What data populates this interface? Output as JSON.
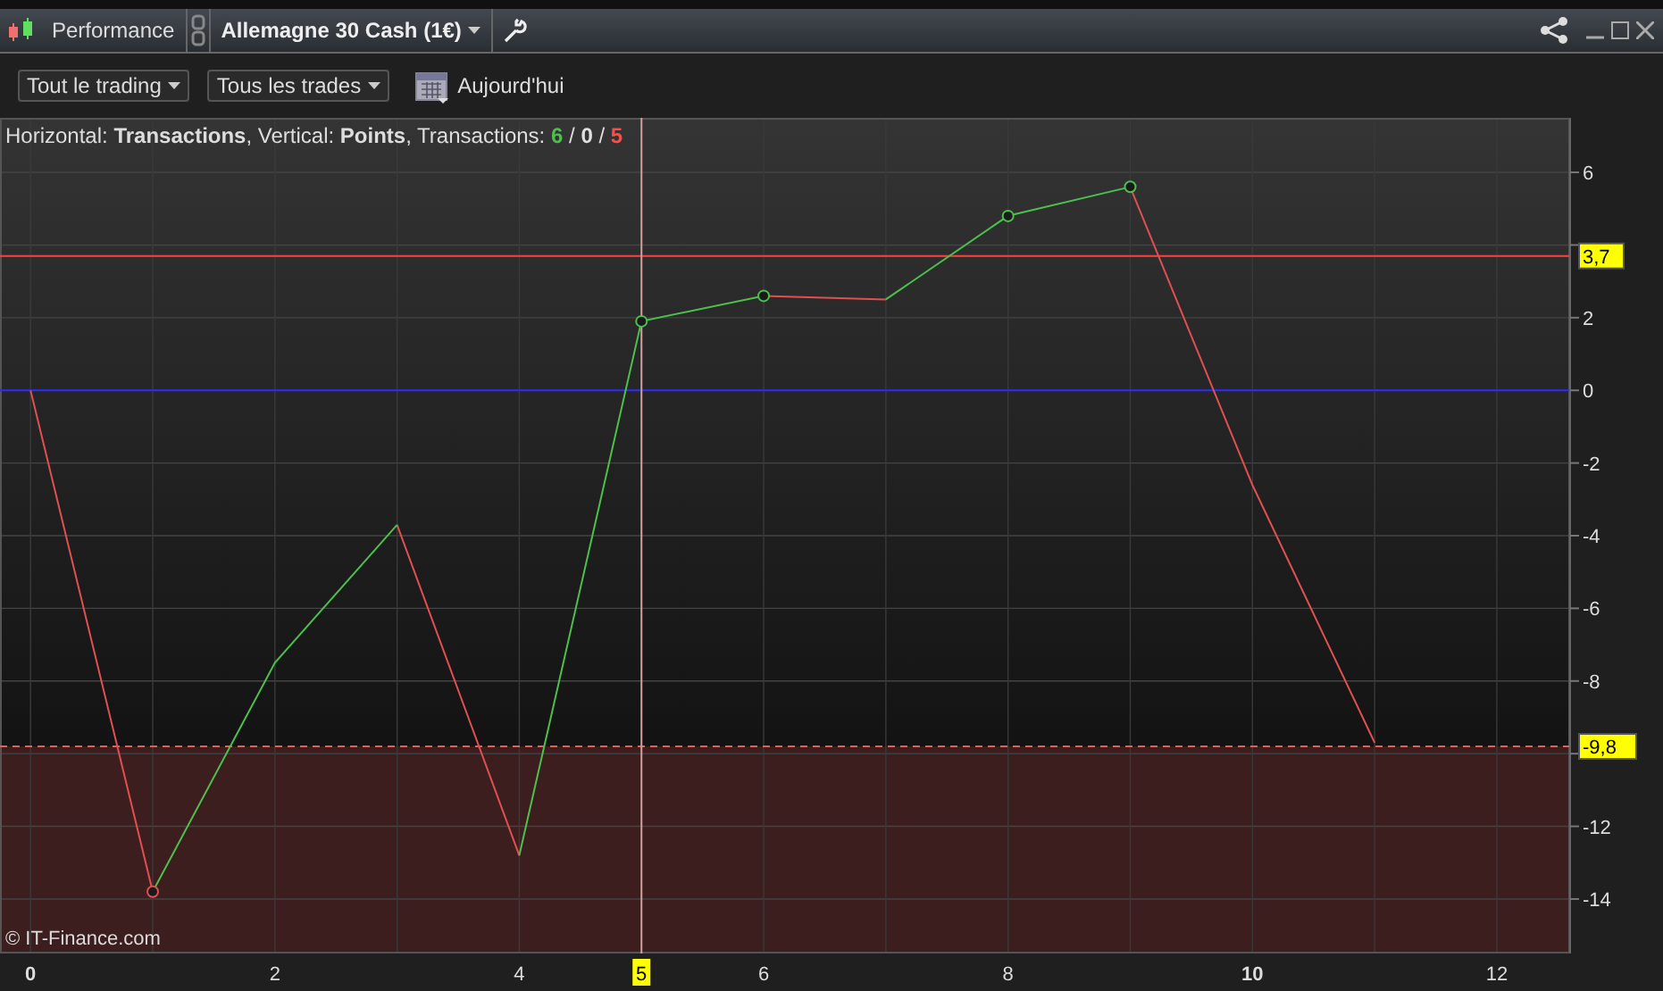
{
  "window": {
    "title": "Performance",
    "instrument": "Allemagne 30 Cash (1€)"
  },
  "toolbar": {
    "filters": [
      {
        "label": "Tout le trading"
      },
      {
        "label": "Tous les trades"
      }
    ],
    "date": "Aujourd'hui"
  },
  "info": {
    "text": "Horizontal: **Transactions**, Vertical: **Points**, Transactions: ",
    "separator": "/",
    "counts": [
      {
        "value": "6",
        "color": "#4cc04c"
      },
      {
        "value": "0",
        "color": "#e0e0e0"
      },
      {
        "value": "5",
        "color": "#ff4a4a"
      }
    ]
  },
  "chart_data": {
    "type": "line",
    "x": [
      0,
      1,
      2,
      3,
      4,
      5,
      6,
      7,
      8,
      9,
      10,
      11
    ],
    "series": [
      {
        "color": "#e05050",
        "values": [
          0,
          -13.8,
          null,
          -3.7,
          -12.8,
          null,
          2.6,
          2.5,
          null,
          5.6,
          -2.6,
          -9.7
        ]
      },
      {
        "color": "#4cc04c",
        "values": [
          null,
          -13.8,
          -7.5,
          -3.7,
          null,
          null,
          null,
          2.5,
          4.8,
          5.6,
          null,
          null
        ]
      },
      {
        "color": "#4cc04c",
        "values": [
          null,
          null,
          null,
          null,
          -12.8,
          1.9,
          2.6,
          null,
          null,
          null,
          null,
          null
        ]
      },
      {
        "color": "#e05050",
        "marker": "circle",
        "values": [
          null,
          -13.8,
          null,
          null,
          null,
          null,
          null,
          null,
          null,
          null,
          null,
          null
        ]
      },
      {
        "color": "#4cc04c",
        "marker": "circle",
        "values": [
          null,
          null,
          null,
          null,
          null,
          1.9,
          null,
          null,
          null,
          null,
          null,
          null
        ]
      },
      {
        "color": "#4cc04c",
        "marker": "circle",
        "values": [
          null,
          null,
          null,
          null,
          null,
          null,
          2.6,
          null,
          null,
          null,
          null,
          null
        ]
      },
      {
        "color": "#4cc04c",
        "marker": "circle",
        "values": [
          null,
          null,
          null,
          null,
          null,
          null,
          null,
          null,
          4.8,
          null,
          null,
          null
        ]
      },
      {
        "color": "#4cc04c",
        "marker": "circle",
        "values": [
          null,
          null,
          null,
          null,
          null,
          null,
          null,
          null,
          null,
          5.6,
          null,
          null
        ]
      }
    ],
    "xlim": [
      -0.25,
      12.6
    ],
    "ylim": [
      -15.5,
      7.5
    ],
    "grid": true,
    "xticks": [
      {
        "value": 0,
        "label": "**0**"
      },
      {
        "value": 2,
        "label": "2"
      },
      {
        "value": 4,
        "label": "4"
      },
      {
        "value": 6,
        "label": "6"
      },
      {
        "value": 8,
        "label": "8"
      },
      {
        "value": 10,
        "label": "**10**"
      },
      {
        "value": 12,
        "label": "12"
      }
    ],
    "yticks": [
      {
        "value": 6,
        "label": "6"
      },
      {
        "value": 2,
        "label": "2"
      },
      {
        "value": 0,
        "label": "0"
      },
      {
        "value": -2,
        "label": "-2"
      },
      {
        "value": -4,
        "label": "-4"
      },
      {
        "value": -6,
        "label": "-6"
      },
      {
        "value": -8,
        "label": "-8"
      },
      {
        "value": -12,
        "label": "-12"
      },
      {
        "value": -14,
        "label": "-14"
      }
    ],
    "ref_lines": [
      {
        "axis": "y",
        "value": 3.7,
        "label": "3,7",
        "color": "#ff4040"
      },
      {
        "axis": "y",
        "value": 0,
        "color": "#2a2aff"
      },
      {
        "axis": "y",
        "value": -9.8,
        "label": "-9,8",
        "color": "#e06060"
      },
      {
        "axis": "x",
        "value": 5,
        "label": "5",
        "color": "#d0a0a0"
      }
    ],
    "bands": [
      {
        "axis": "y",
        "from": -15.5,
        "to": -9.8,
        "color": "#3c1e1e"
      }
    ]
  },
  "copyright": "© IT-Finance.com"
}
